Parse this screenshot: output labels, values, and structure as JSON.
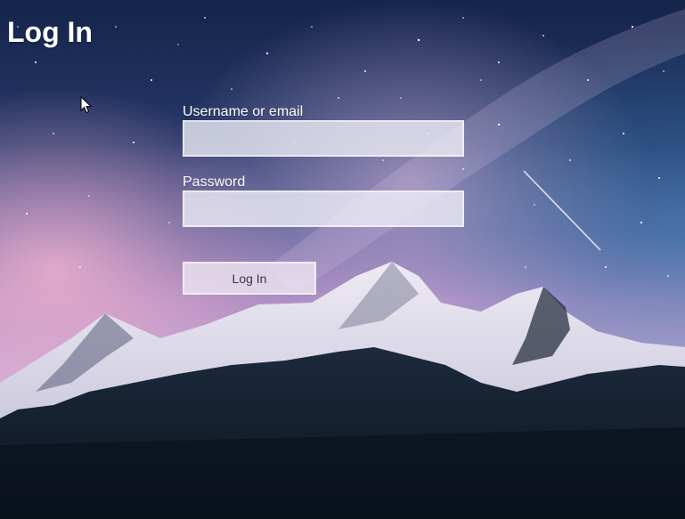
{
  "page": {
    "title": "Log In"
  },
  "form": {
    "username": {
      "label": "Username or email",
      "value": "",
      "placeholder": ""
    },
    "password": {
      "label": "Password",
      "value": "",
      "placeholder": ""
    },
    "submit_label": "Log In"
  },
  "background": {
    "sky_top": "#1a2a50",
    "sky_mid": "#3a4d80",
    "glow_pink": "#d89cc8",
    "glow_purple": "#a080c0",
    "snow": "#e6e4ef",
    "forest": "#101a28"
  }
}
